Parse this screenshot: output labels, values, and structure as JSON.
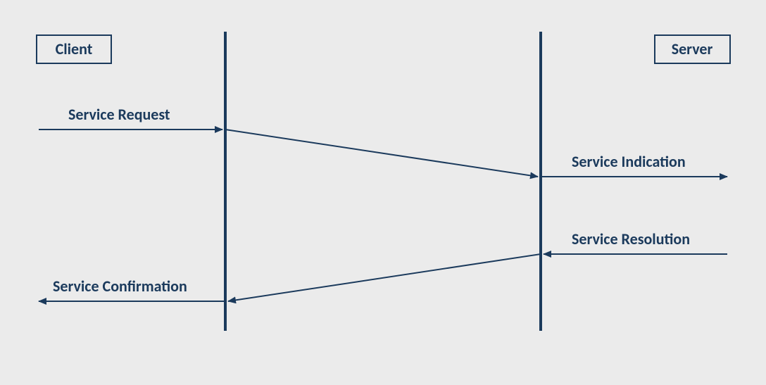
{
  "diagram": {
    "client_label": "Client",
    "server_label": "Server",
    "messages": {
      "request": "Service Request",
      "indication": "Service Indication",
      "resolution": "Service Resolution",
      "confirmation": "Service Confirmation"
    }
  }
}
